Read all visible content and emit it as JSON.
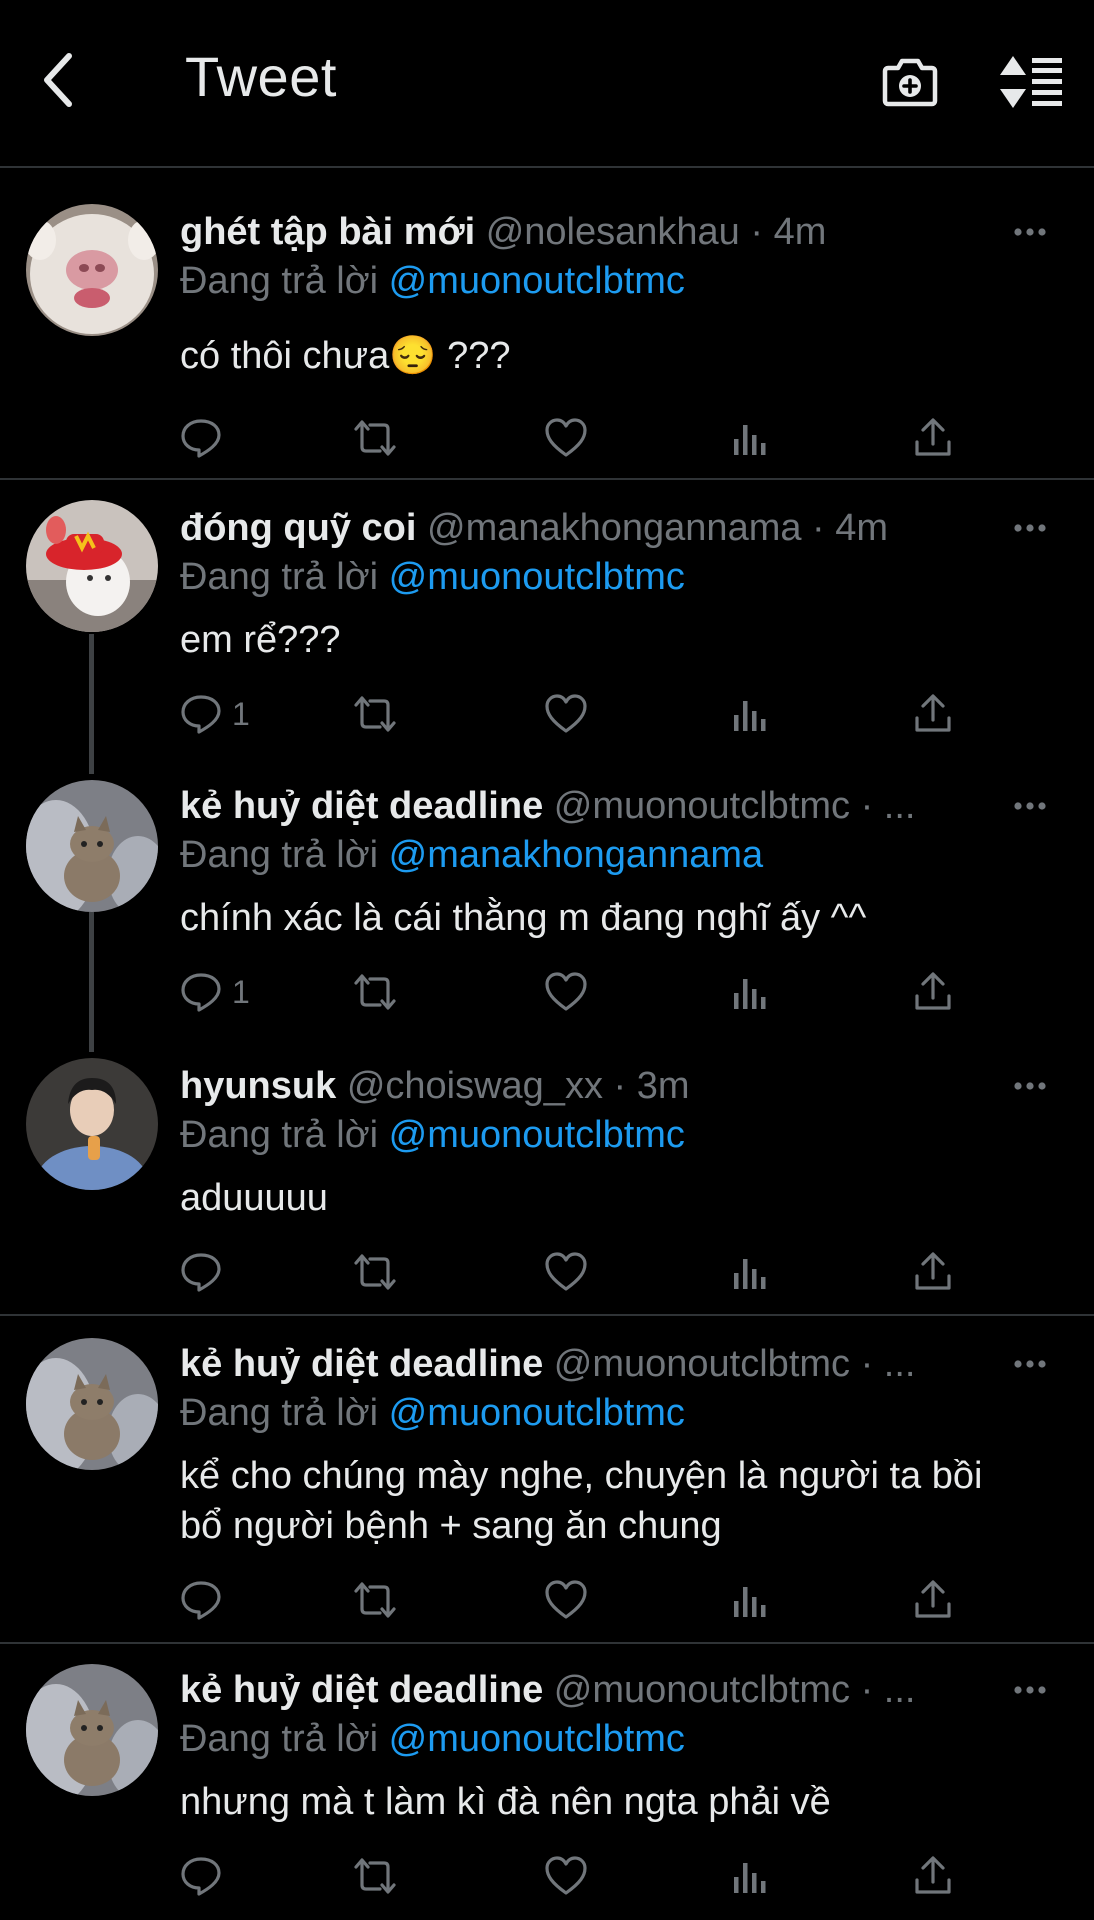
{
  "header": {
    "title": "Tweet",
    "back_icon": "chevron-left-icon",
    "camera_icon": "camera-plus-icon",
    "sort_icon": "sort-list-icon"
  },
  "colors": {
    "background": "#000000",
    "text": "#e7e9ea",
    "muted": "#71767b",
    "link": "#1d9bf0",
    "divider": "#2f3336"
  },
  "tweets": [
    {
      "name": "ghét tập bài mới",
      "handle_time": "@nolesankhau · 4m",
      "replying_prefix": "Đang trả lời",
      "replying_to": "@muonoutclbtmc",
      "text": "có thôi chưa😔 ???",
      "reply_count": ""
    },
    {
      "name": "đóng quỹ coi",
      "handle_time": "@manakhongannama · 4m",
      "replying_prefix": "Đang trả lời",
      "replying_to": "@muonoutclbtmc",
      "text": "em rể???",
      "reply_count": "1"
    },
    {
      "name": "kẻ huỷ diệt deadline",
      "handle_time": "@muonoutclbtmc · ...",
      "replying_prefix": "Đang trả lời",
      "replying_to": "@manakhongannama",
      "text": "chính xác là cái thằng m đang nghĩ ấy ^^",
      "reply_count": "1"
    },
    {
      "name": "hyunsuk",
      "handle_time": "@choiswag_xx · 3m",
      "replying_prefix": "Đang trả lời",
      "replying_to": "@muonoutclbtmc",
      "text": "aduuuuu",
      "reply_count": ""
    },
    {
      "name": "kẻ huỷ diệt deadline",
      "handle_time": "@muonoutclbtmc · ...",
      "replying_prefix": "Đang trả lời",
      "replying_to": "@muonoutclbtmc",
      "text": "kể cho chúng mày nghe, chuyện là người ta bồi bổ người bệnh + sang ăn chung",
      "reply_count": ""
    },
    {
      "name": "kẻ huỷ diệt deadline",
      "handle_time": "@muonoutclbtmc · ...",
      "replying_prefix": "Đang trả lời",
      "replying_to": "@muonoutclbtmc",
      "text": "nhưng mà t làm kì đà nên ngta phải về",
      "reply_count": ""
    }
  ]
}
